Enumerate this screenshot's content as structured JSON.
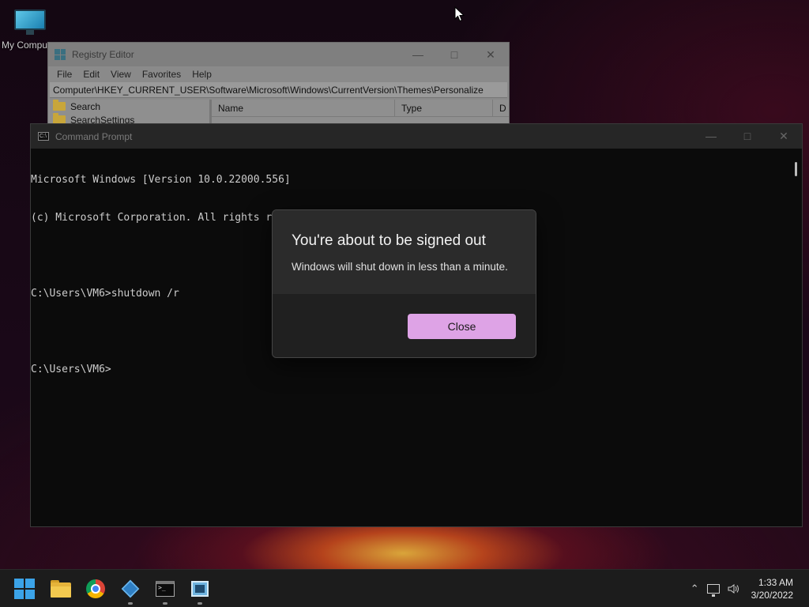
{
  "desktop": {
    "icons": [
      {
        "label": "My Compu",
        "icon": "monitor-icon"
      }
    ]
  },
  "regedit": {
    "title": "Registry Editor",
    "menu": [
      "File",
      "Edit",
      "View",
      "Favorites",
      "Help"
    ],
    "address": "Computer\\HKEY_CURRENT_USER\\Software\\Microsoft\\Windows\\CurrentVersion\\Themes\\Personalize",
    "tree": [
      "Search",
      "SearchSettings"
    ],
    "columns": [
      "Name",
      "Type",
      "D"
    ]
  },
  "cmd": {
    "title": "Command Prompt",
    "lines": [
      "Microsoft Windows [Version 10.0.22000.556]",
      "(c) Microsoft Corporation. All rights reserved.",
      "",
      "C:\\Users\\VM6>shutdown /r",
      "",
      "C:\\Users\\VM6>"
    ]
  },
  "dialog": {
    "title": "You're about to be signed out",
    "message": "Windows will shut down in less than a minute.",
    "button": "Close",
    "accent": "#dea3e6"
  },
  "taskbar": {
    "apps": [
      "start-icon",
      "file-explorer-icon",
      "chrome-icon",
      "registry-editor-icon",
      "command-prompt-icon",
      "notepad-icon"
    ],
    "clock": {
      "time": "1:33 AM",
      "date": "3/20/2022"
    }
  }
}
